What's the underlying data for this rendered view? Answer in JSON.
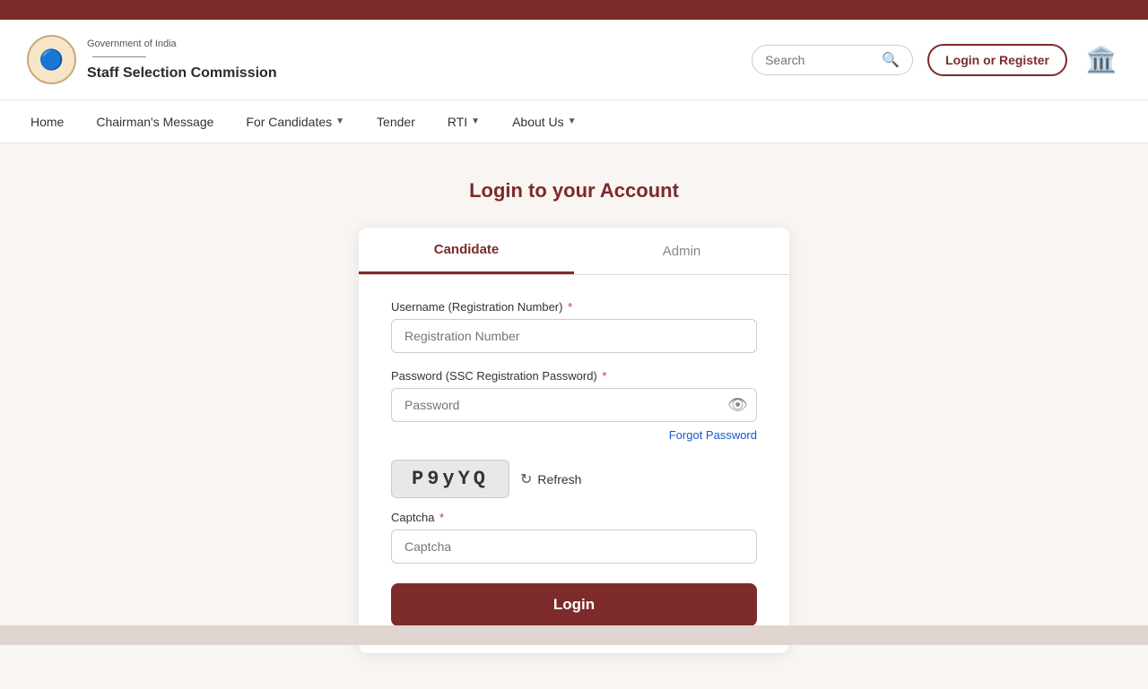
{
  "topbar": {},
  "header": {
    "gov_text": "Government of India",
    "org_text": "Staff Selection Commission",
    "search_placeholder": "Search",
    "login_register_label": "Login or Register"
  },
  "nav": {
    "items": [
      {
        "label": "Home",
        "has_arrow": false
      },
      {
        "label": "Chairman's Message",
        "has_arrow": false
      },
      {
        "label": "For Candidates",
        "has_arrow": true
      },
      {
        "label": "Tender",
        "has_arrow": false
      },
      {
        "label": "RTI",
        "has_arrow": true
      },
      {
        "label": "About Us",
        "has_arrow": true
      }
    ]
  },
  "page": {
    "title": "Login to your Account"
  },
  "login": {
    "tabs": [
      {
        "label": "Candidate",
        "active": true
      },
      {
        "label": "Admin",
        "active": false
      }
    ],
    "username_label": "Username (Registration Number)",
    "username_placeholder": "Registration Number",
    "password_label": "Password (SSC Registration Password)",
    "password_placeholder": "Password",
    "forgot_password_label": "Forgot Password",
    "captcha_value": "P9yYQ",
    "refresh_label": "Refresh",
    "captcha_label": "Captcha",
    "captcha_placeholder": "Captcha",
    "login_btn_label": "Login",
    "required_mark": "*"
  }
}
